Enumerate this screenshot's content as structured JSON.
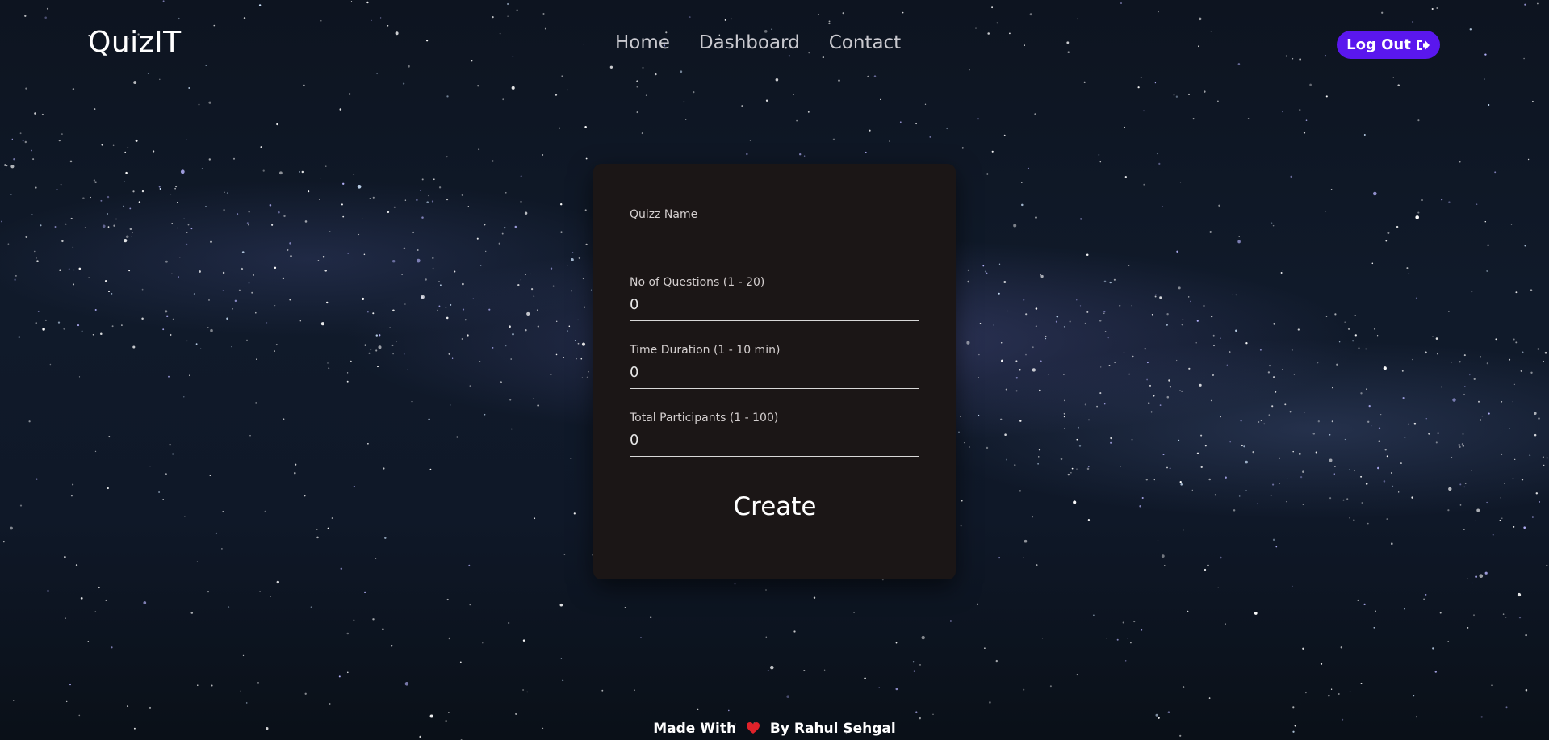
{
  "header": {
    "logo": "QuizIT",
    "nav": [
      {
        "label": "Home"
      },
      {
        "label": "Dashboard"
      },
      {
        "label": "Contact"
      }
    ],
    "logout_label": "Log Out",
    "logout_icon": "sign-out-icon"
  },
  "form": {
    "fields": [
      {
        "label": "Quizz Name",
        "value": ""
      },
      {
        "label": "No of Questions (1 - 20)",
        "value": "0"
      },
      {
        "label": "Time Duration (1 - 10 min)",
        "value": "0"
      },
      {
        "label": "Total Participants (1 - 100)",
        "value": "0"
      }
    ],
    "submit_label": "Create"
  },
  "footer": {
    "prefix": "Made With",
    "heart_icon": "heart-icon",
    "suffix": "By Rahul Sehgal"
  },
  "colors": {
    "accent": "#5a17ee",
    "card_bg": "#1b1616",
    "background": "#0f1828",
    "heart": "#e0222a"
  }
}
